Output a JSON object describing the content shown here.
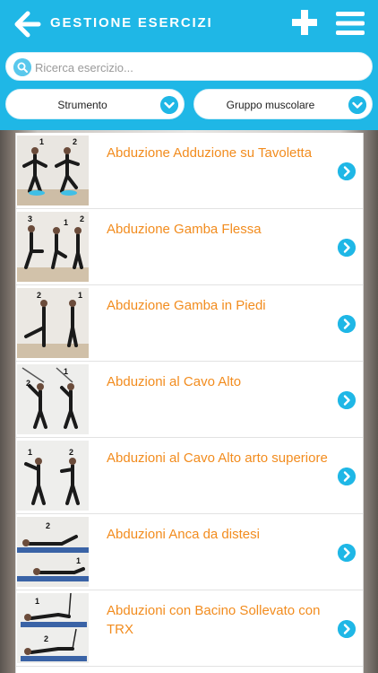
{
  "header": {
    "title": "GESTIONE ESERCIZI",
    "back_icon": "arrow-left-icon",
    "add_icon": "plus-icon",
    "menu_icon": "hamburger-menu-icon",
    "background": "#1fb7e6"
  },
  "search": {
    "placeholder": "Ricerca esercizio...",
    "value": ""
  },
  "filters": {
    "strumento": "Strumento",
    "gruppo": "Gruppo muscolare"
  },
  "exercises": [
    {
      "title": "Abduzione Adduzione su Tavoletta",
      "steps": [
        "1",
        "2"
      ]
    },
    {
      "title": "Abduzione Gamba Flessa",
      "steps": [
        "3",
        "1",
        "2"
      ]
    },
    {
      "title": "Abduzione Gamba in Piedi",
      "steps": [
        "2",
        "1"
      ]
    },
    {
      "title": "Abduzioni al Cavo Alto",
      "steps": [
        "2",
        "1"
      ]
    },
    {
      "title": "Abduzioni al Cavo Alto arto superiore",
      "steps": [
        "1",
        "2"
      ]
    },
    {
      "title": "Abduzioni Anca da distesi",
      "steps": [
        "2",
        "1"
      ]
    },
    {
      "title": "Abduzioni con Bacino Sollevato con TRX",
      "steps": [
        "1",
        "2"
      ]
    }
  ],
  "colors": {
    "accent": "#1fb7e6",
    "title_orange": "#f28c1e"
  }
}
